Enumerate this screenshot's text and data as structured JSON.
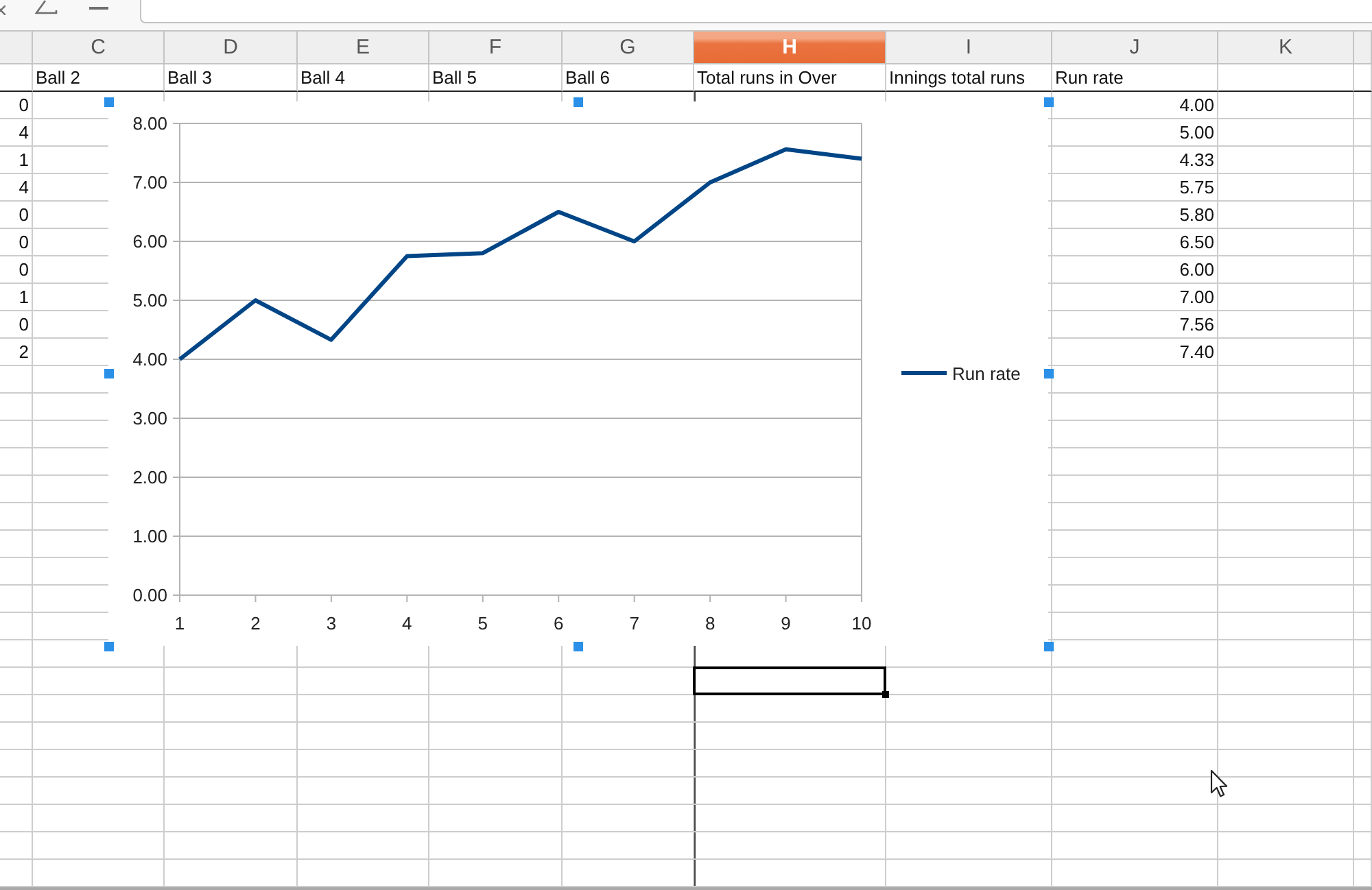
{
  "columns": [
    {
      "selected": false,
      "values": [
        "0",
        "4",
        "1",
        "4",
        "0",
        "0",
        "0",
        "1",
        "0",
        "2"
      ]
    },
    {
      "letter": "C",
      "heading": "Ball 2",
      "selected": false
    },
    {
      "letter": "D",
      "heading": "Ball 3",
      "selected": false
    },
    {
      "letter": "E",
      "heading": "Ball 4",
      "selected": false
    },
    {
      "letter": "F",
      "heading": "Ball 5",
      "selected": false
    },
    {
      "letter": "G",
      "heading": "Ball 6",
      "selected": false
    },
    {
      "letter": "H",
      "heading": "Total runs in Over",
      "selected": true
    },
    {
      "letter": "I",
      "heading": "Innings total runs",
      "selected": false
    },
    {
      "letter": "J",
      "heading": "Run rate",
      "selected": false,
      "values": [
        "4.00",
        "5.00",
        "4.33",
        "5.75",
        "5.80",
        "6.50",
        "6.00",
        "7.00",
        "7.56",
        "7.40"
      ]
    },
    {
      "letter": "K",
      "selected": false
    }
  ],
  "rows_below_chart": [
    {
      "selected": false
    },
    {
      "selected": true
    },
    {
      "selected": false
    },
    {
      "selected": false
    },
    {
      "selected": false
    },
    {
      "selected": false
    },
    {
      "selected": false
    },
    {
      "selected": false
    },
    {
      "selected": false
    }
  ],
  "chart": {
    "selected": true,
    "chart_data": {
      "type": "line",
      "categories": [
        "1",
        "2",
        "3",
        "4",
        "5",
        "6",
        "7",
        "8",
        "9",
        "10"
      ],
      "series": [
        {
          "name": "Run rate",
          "color": "#004586",
          "values": [
            4.0,
            5.0,
            4.33,
            5.75,
            5.8,
            6.5,
            6.0,
            7.0,
            7.56,
            7.4
          ]
        }
      ],
      "ylim": [
        0,
        8
      ],
      "yticks": [
        {
          "value": 0,
          "label": "0.00"
        },
        {
          "value": 1,
          "label": "1.00"
        },
        {
          "value": 2,
          "label": "2.00"
        },
        {
          "value": 3,
          "label": "3.00"
        },
        {
          "value": 4,
          "label": "4.00"
        },
        {
          "value": 5,
          "label": "5.00"
        },
        {
          "value": 6,
          "label": "6.00"
        },
        {
          "value": 7,
          "label": "7.00"
        },
        {
          "value": 8,
          "label": "8.00"
        }
      ],
      "grid": true
    }
  }
}
